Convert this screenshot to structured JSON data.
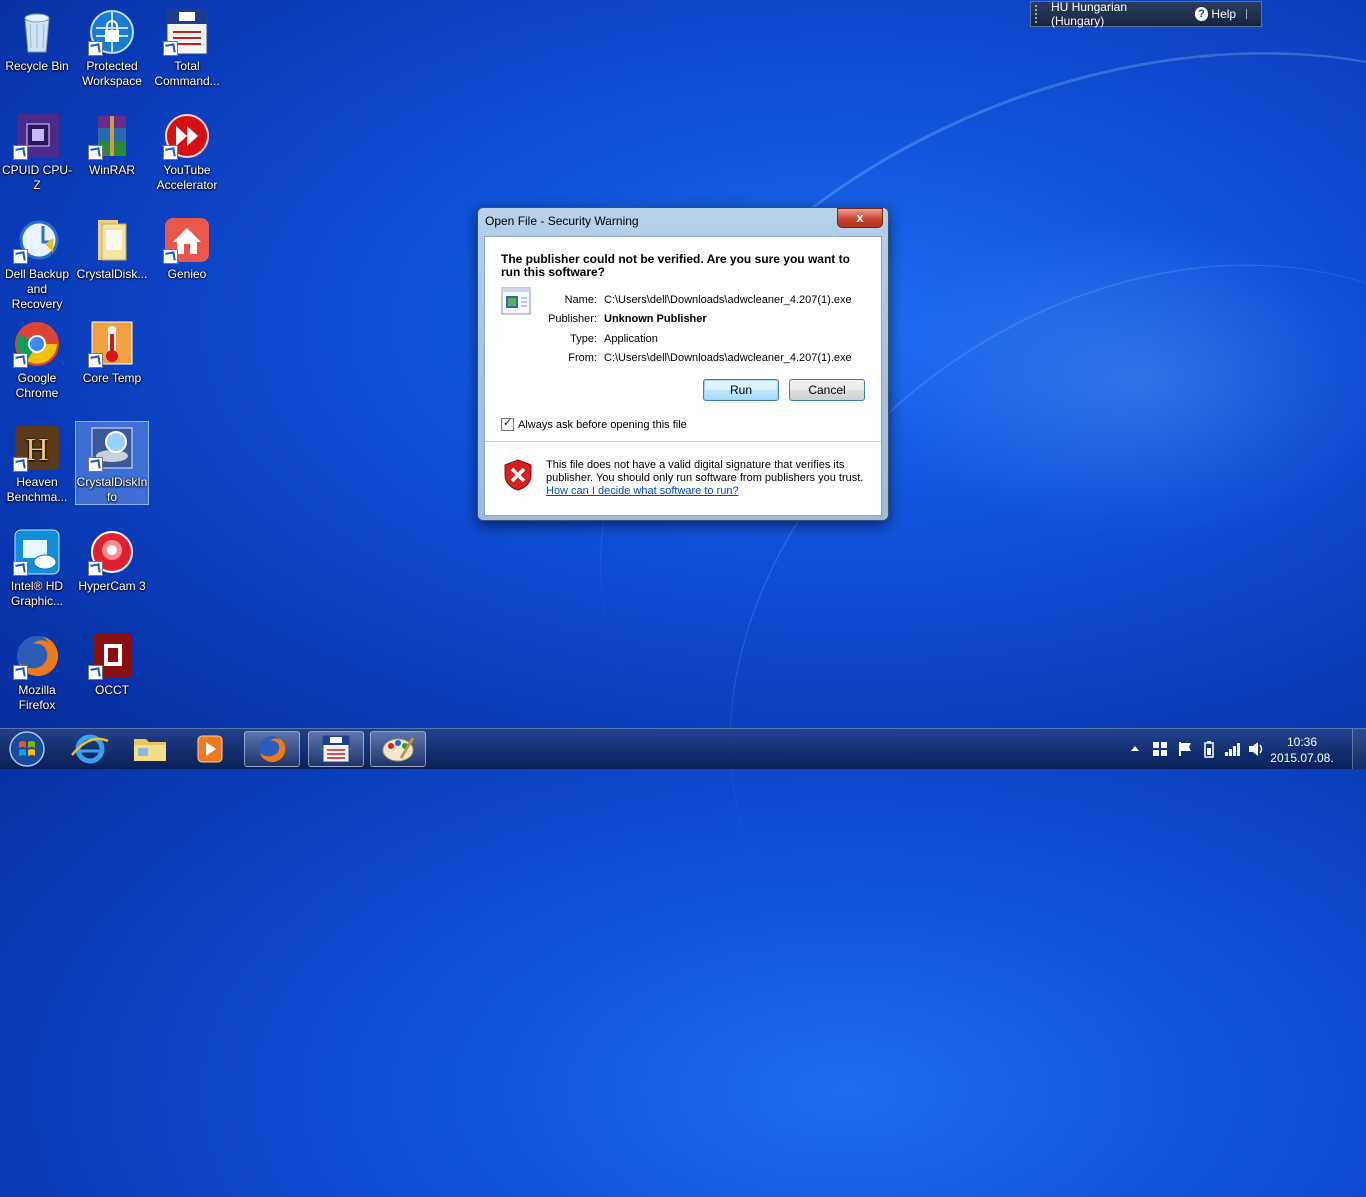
{
  "language_bar": {
    "language": "HU Hungarian (Hungary)",
    "help": "Help"
  },
  "desktop_icons": [
    {
      "label": "Recycle Bin",
      "icon": "recycle-bin-icon"
    },
    {
      "label": "Protected Workspace",
      "icon": "protected-workspace-icon"
    },
    {
      "label": "Total Command...",
      "icon": "total-commander-icon"
    },
    {
      "label": "CPUID CPU-Z",
      "icon": "cpuz-icon"
    },
    {
      "label": "WinRAR",
      "icon": "winrar-icon"
    },
    {
      "label": "YouTube Accelerator",
      "icon": "youtube-accelerator-icon"
    },
    {
      "label": "Dell Backup and Recovery",
      "icon": "dell-backup-icon"
    },
    {
      "label": "CrystalDisk...",
      "icon": "folder-icon"
    },
    {
      "label": "Genieo",
      "icon": "genieo-icon"
    },
    {
      "label": "Google Chrome",
      "icon": "chrome-icon"
    },
    {
      "label": "Core Temp",
      "icon": "core-temp-icon"
    },
    {
      "label": "Heaven Benchma...",
      "icon": "heaven-benchmark-icon"
    },
    {
      "label": "CrystalDiskInfo",
      "icon": "crystaldiskinfo-icon"
    },
    {
      "label": "Intel® HD Graphic...",
      "icon": "intel-hd-icon"
    },
    {
      "label": "HyperCam 3",
      "icon": "hypercam-icon"
    },
    {
      "label": "Mozilla Firefox",
      "icon": "firefox-icon"
    },
    {
      "label": "OCCT",
      "icon": "occt-icon"
    }
  ],
  "dialog": {
    "title": "Open File - Security Warning",
    "close": "x",
    "heading": "The publisher could not be verified.  Are you sure you want to run this software?",
    "fields": [
      {
        "key": "Name:",
        "value": "C:\\Users\\dell\\Downloads\\adwcleaner_4.207(1).exe"
      },
      {
        "key": "Publisher:",
        "value": "Unknown Publisher"
      },
      {
        "key": "Type:",
        "value": "Application"
      },
      {
        "key": "From:",
        "value": "C:\\Users\\dell\\Downloads\\adwcleaner_4.207(1).exe"
      }
    ],
    "run_label": "Run",
    "cancel_label": "Cancel",
    "checkbox_label": "Always ask before opening this file",
    "checkbox_checked": true,
    "warning_text": "This file does not have a valid digital signature that verifies its publisher.  You should only run software from publishers you trust.",
    "warning_link": "How can I decide what software to run?"
  },
  "taskbar": {
    "items": [
      "start-orb-icon",
      "internet-explorer-icon",
      "explorer-folder-icon",
      "media-player-icon",
      "firefox-icon",
      "total-commander-icon",
      "paint-icon"
    ],
    "clock_time": "10:36",
    "clock_date": "2015.07.08."
  }
}
